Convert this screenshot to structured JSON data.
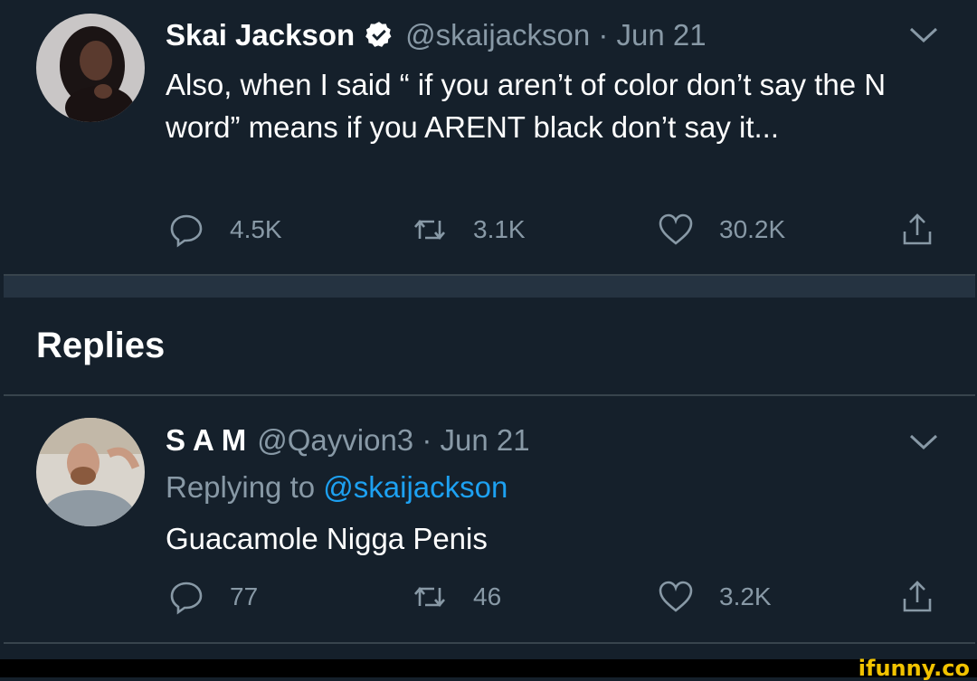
{
  "main_tweet": {
    "name": "Skai Jackson",
    "handle_date": "@skaijackson · Jun 21",
    "text": "Also, when I said “ if you aren’t of color don’t say the N word” means if you ARENT black don’t say it...",
    "replies": "4.5K",
    "retweets": "3.1K",
    "likes": "30.2K"
  },
  "replies_section": {
    "title": "Replies"
  },
  "reply_tweet": {
    "name": "S A M",
    "handle_date": "@Qayvion3 · Jun 21",
    "replying_prefix": "Replying to ",
    "replying_mention": "@skaijackson",
    "text": "Guacamole Nigga Penis",
    "replies": "77",
    "retweets": "46",
    "likes": "3.2K"
  },
  "watermark": "ifunny.co",
  "colors": {
    "background": "#15202b",
    "secondary_text": "#8899a6",
    "accent": "#1da1f2",
    "divider": "#38444d"
  },
  "icons": [
    "verified-badge-icon",
    "chevron-down-icon",
    "reply-icon",
    "retweet-icon",
    "like-icon",
    "share-icon"
  ]
}
